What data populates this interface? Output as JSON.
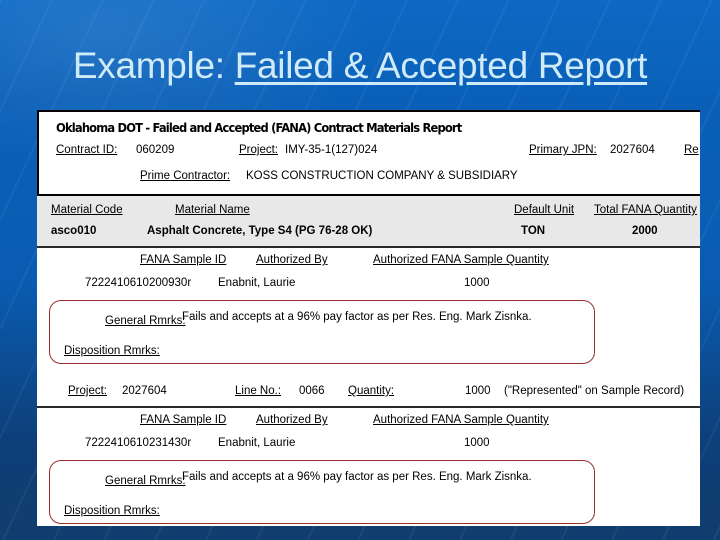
{
  "slide": {
    "title_plain": "Example: ",
    "title_underlined": "Failed & Accepted Report",
    "bg_color": "#0a60b8",
    "title_color": "#cfeaf8"
  },
  "report": {
    "header": {
      "title": "Oklahoma DOT -  Failed and Accepted (FANA) Contract Materials Report",
      "contract_id_label": "Contract ID:",
      "contract_id_value": "060209",
      "project_label": "Project:",
      "project_value": "IMY-35-1(127)024",
      "primary_jpn_label": "Primary JPN:",
      "primary_jpn_value": "2027604",
      "clipped_label": "Re",
      "prime_contractor_label": "Prime Contractor:",
      "prime_contractor_value": "KOSS CONSTRUCTION COMPANY & SUBSIDIARY"
    },
    "material": {
      "material_code_label": "Material Code",
      "material_code_value": "asco010",
      "material_name_label": "Material Name",
      "material_name_value": "Asphalt Concrete, Type S4 (PG 76-28 OK)",
      "default_unit_label": "Default Unit",
      "default_unit_value": "TON",
      "total_fana_quantity_label": "Total FANA Quantity",
      "total_fana_quantity_value": "2000"
    },
    "sample_columns": {
      "sample_id_label": "FANA  Sample ID",
      "authorized_by_label": "Authorized By",
      "authorized_quantity_label": "Authorized FANA  Sample Quantity"
    },
    "remarks_labels": {
      "general_label": "General Rmrks:",
      "disposition_label": "Disposition  Rmrks:"
    },
    "sections": [
      {
        "sample_id": "7222410610200930r",
        "authorized_by": "Enabnit, Laurie",
        "authorized_quantity": "1000",
        "general_remarks": "Fails and accepts at a 96% pay factor as per Res. Eng. Mark Zisnka.",
        "disposition_remarks": ""
      },
      {
        "project_label": "Project:",
        "project_value": "2027604",
        "line_no_label": "Line No.:",
        "line_no_value": "0066",
        "quantity_label": "Quantity:",
        "quantity_value": "1000",
        "quantity_note": "(\"Represented\" on Sample Record)",
        "sample_id": "7222410610231430r",
        "authorized_by": "Enabnit, Laurie",
        "authorized_quantity": "1000",
        "general_remarks": "Fails and accepts at a 96% pay factor as per Res. Eng. Mark Zisnka.",
        "disposition_remarks": ""
      }
    ]
  }
}
